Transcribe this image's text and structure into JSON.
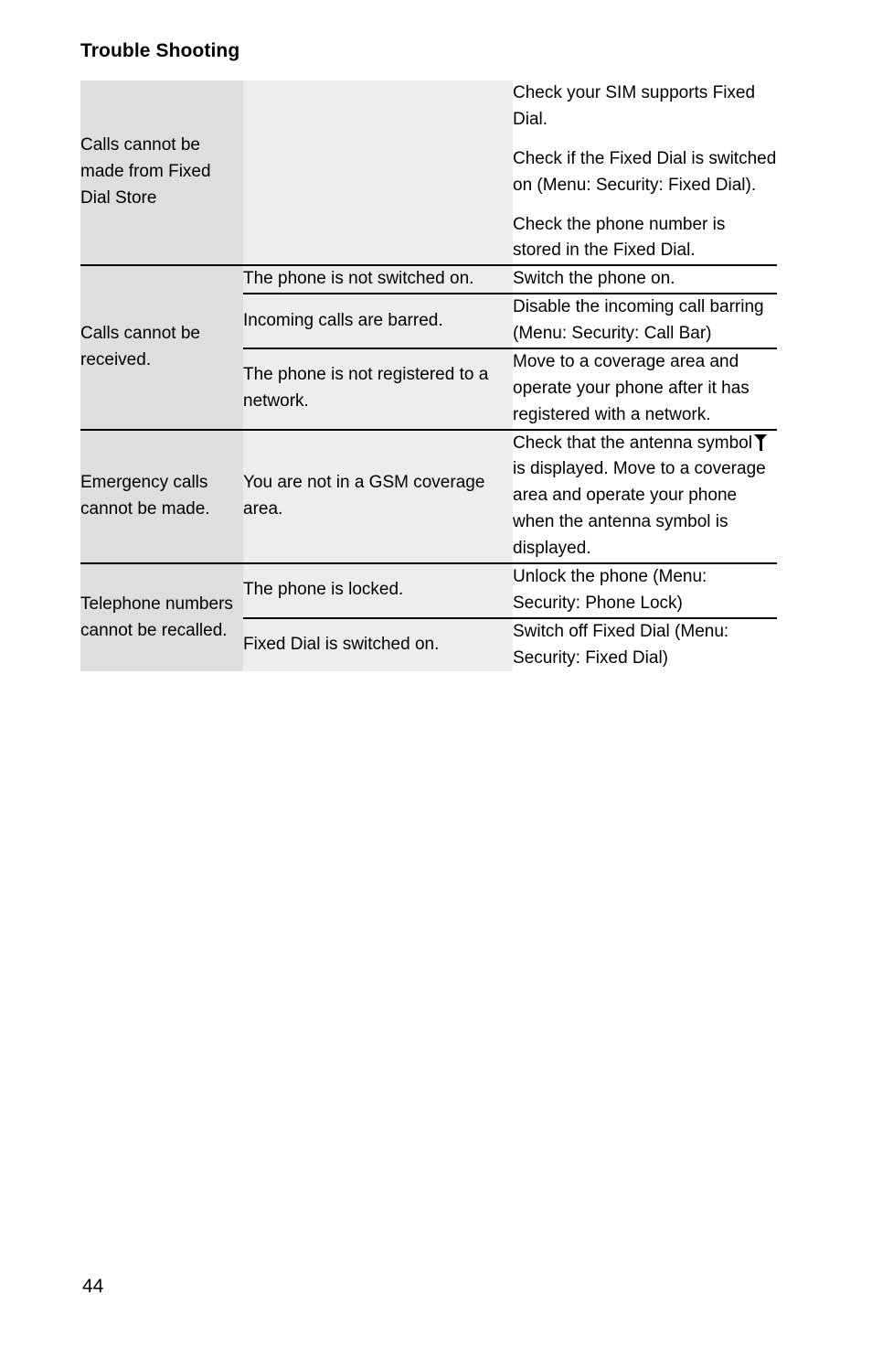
{
  "document": {
    "title": "Trouble Shooting",
    "page_number": "44",
    "colors": {
      "problem_column_bg": "#dedede",
      "cause_column_bg": "#ededed",
      "solution_column_bg": "#ffffff",
      "rule": "#000000",
      "text": "#000000"
    }
  },
  "table": {
    "sections": [
      {
        "problem": "Calls cannot be made from Fixed Dial Store",
        "rows": [
          {
            "cause": "",
            "solution_paragraphs": [
              "Check your SIM supports Fixed Dial.",
              "Check if the Fixed Dial is switched on (Menu: Security: Fixed Dial).",
              "Check the phone number is stored in the Fixed Dial."
            ]
          }
        ]
      },
      {
        "problem": "Calls cannot be received.",
        "rows": [
          {
            "cause": "The phone is not switched on.",
            "solution_paragraphs": [
              "Switch the phone on."
            ]
          },
          {
            "cause": "Incoming calls are barred.",
            "solution_paragraphs": [
              "Disable the incoming call barring (Menu: Security: Call Bar)"
            ]
          },
          {
            "cause": "The phone is not registered to a network.",
            "solution_paragraphs": [
              "Move to a coverage area and operate your phone after it has registered with a network."
            ]
          }
        ]
      },
      {
        "problem": "Emergency calls cannot be made.",
        "rows": [
          {
            "cause": "You are not in a GSM coverage area.",
            "solution_icon": "antenna-icon",
            "solution_before_icon": "Check that the antenna symbol",
            "solution_after_icon": "is displayed. Move to a coverage area and operate your phone when the antenna symbol is displayed."
          }
        ]
      },
      {
        "problem": "Telephone numbers cannot be recalled.",
        "rows": [
          {
            "cause": "The phone is locked.",
            "solution_paragraphs": [
              "Unlock the phone (Menu: Security: Phone Lock)"
            ]
          },
          {
            "cause": "Fixed Dial is switched on.",
            "solution_paragraphs": [
              "Switch off Fixed Dial (Menu: Security: Fixed Dial)"
            ]
          }
        ]
      }
    ]
  }
}
